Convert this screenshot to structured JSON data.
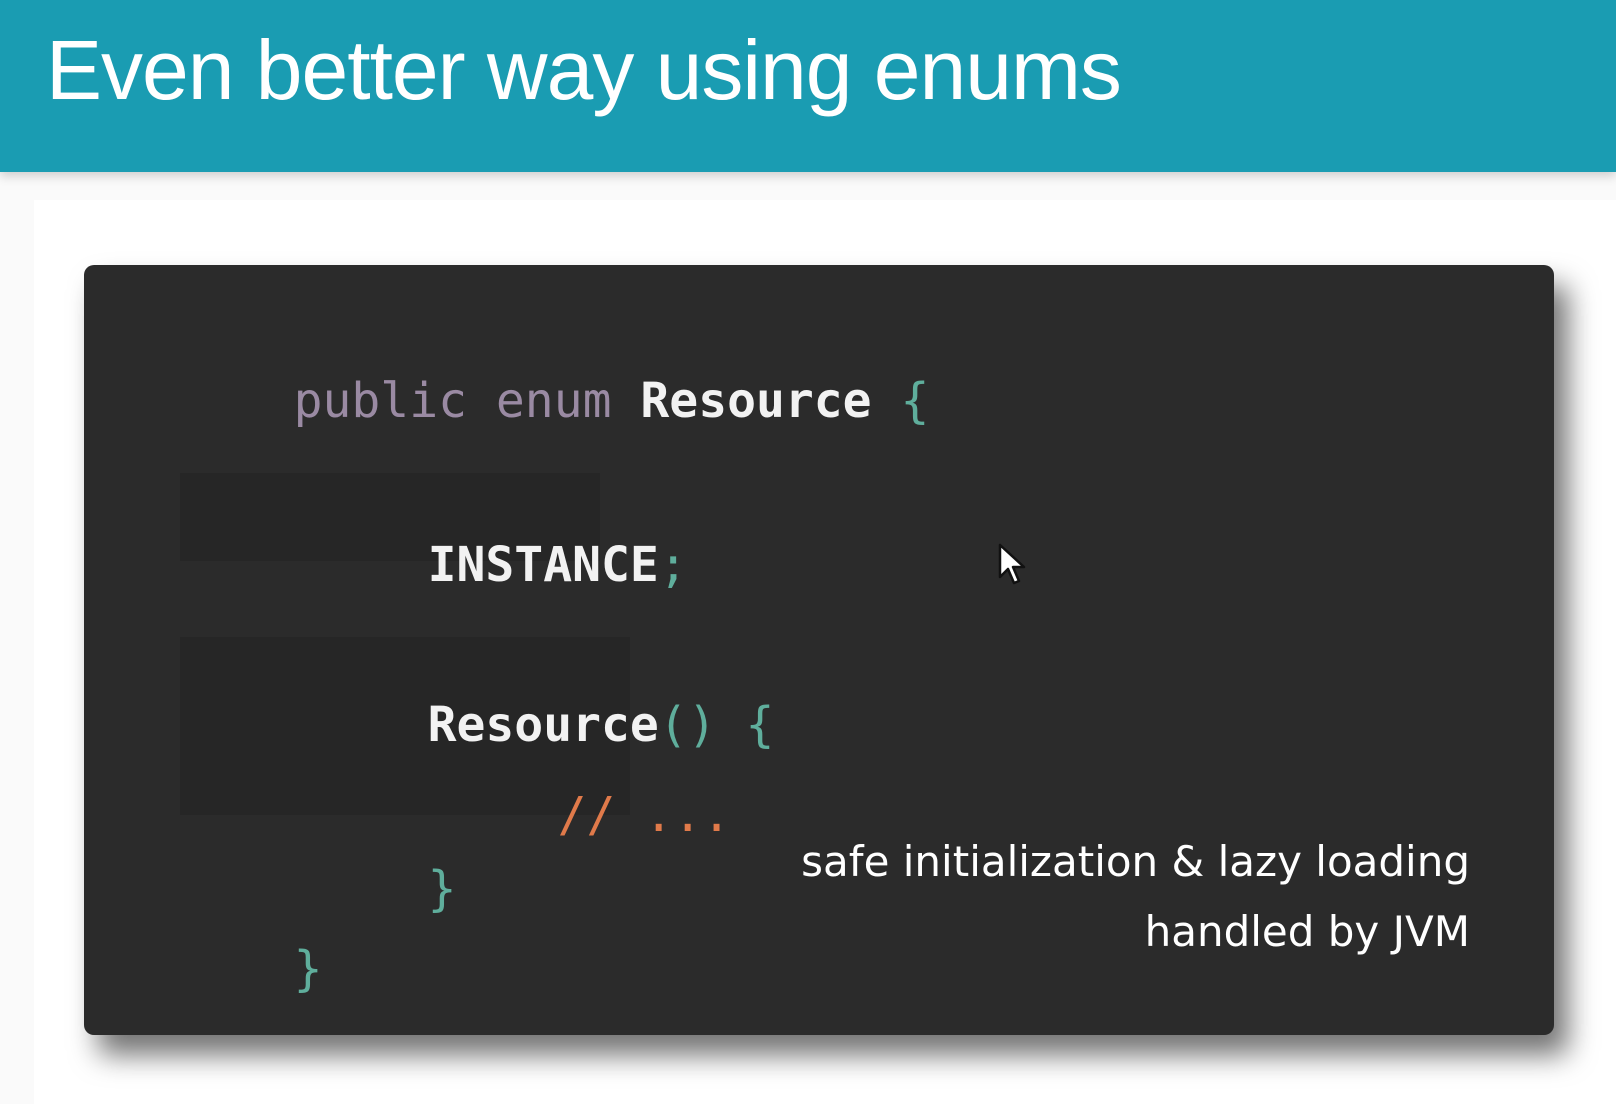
{
  "slide": {
    "title": "Even better way using enums"
  },
  "code": {
    "line1": {
      "kw1": "public",
      "kw2": "enum",
      "name": "Resource",
      "brace": "{"
    },
    "line2": {
      "constant": "INSTANCE",
      "semicolon": ";"
    },
    "line3": {
      "name": "Resource",
      "parens": "()",
      "brace": "{"
    },
    "line4": {
      "comment": "// ..."
    },
    "line5": {
      "brace": "}"
    },
    "line6": {
      "brace": "}"
    }
  },
  "annotation": {
    "line1": "safe initialization & lazy loading",
    "line2": "handled by JVM"
  },
  "colors": {
    "title_bar": "#1a9cb2",
    "code_bg": "#2b2b2b",
    "keyword": "#9a8aa3",
    "brace": "#5fae9c",
    "comment": "#e07a4a"
  },
  "icons": {
    "pointer": "mouse-pointer-icon"
  }
}
